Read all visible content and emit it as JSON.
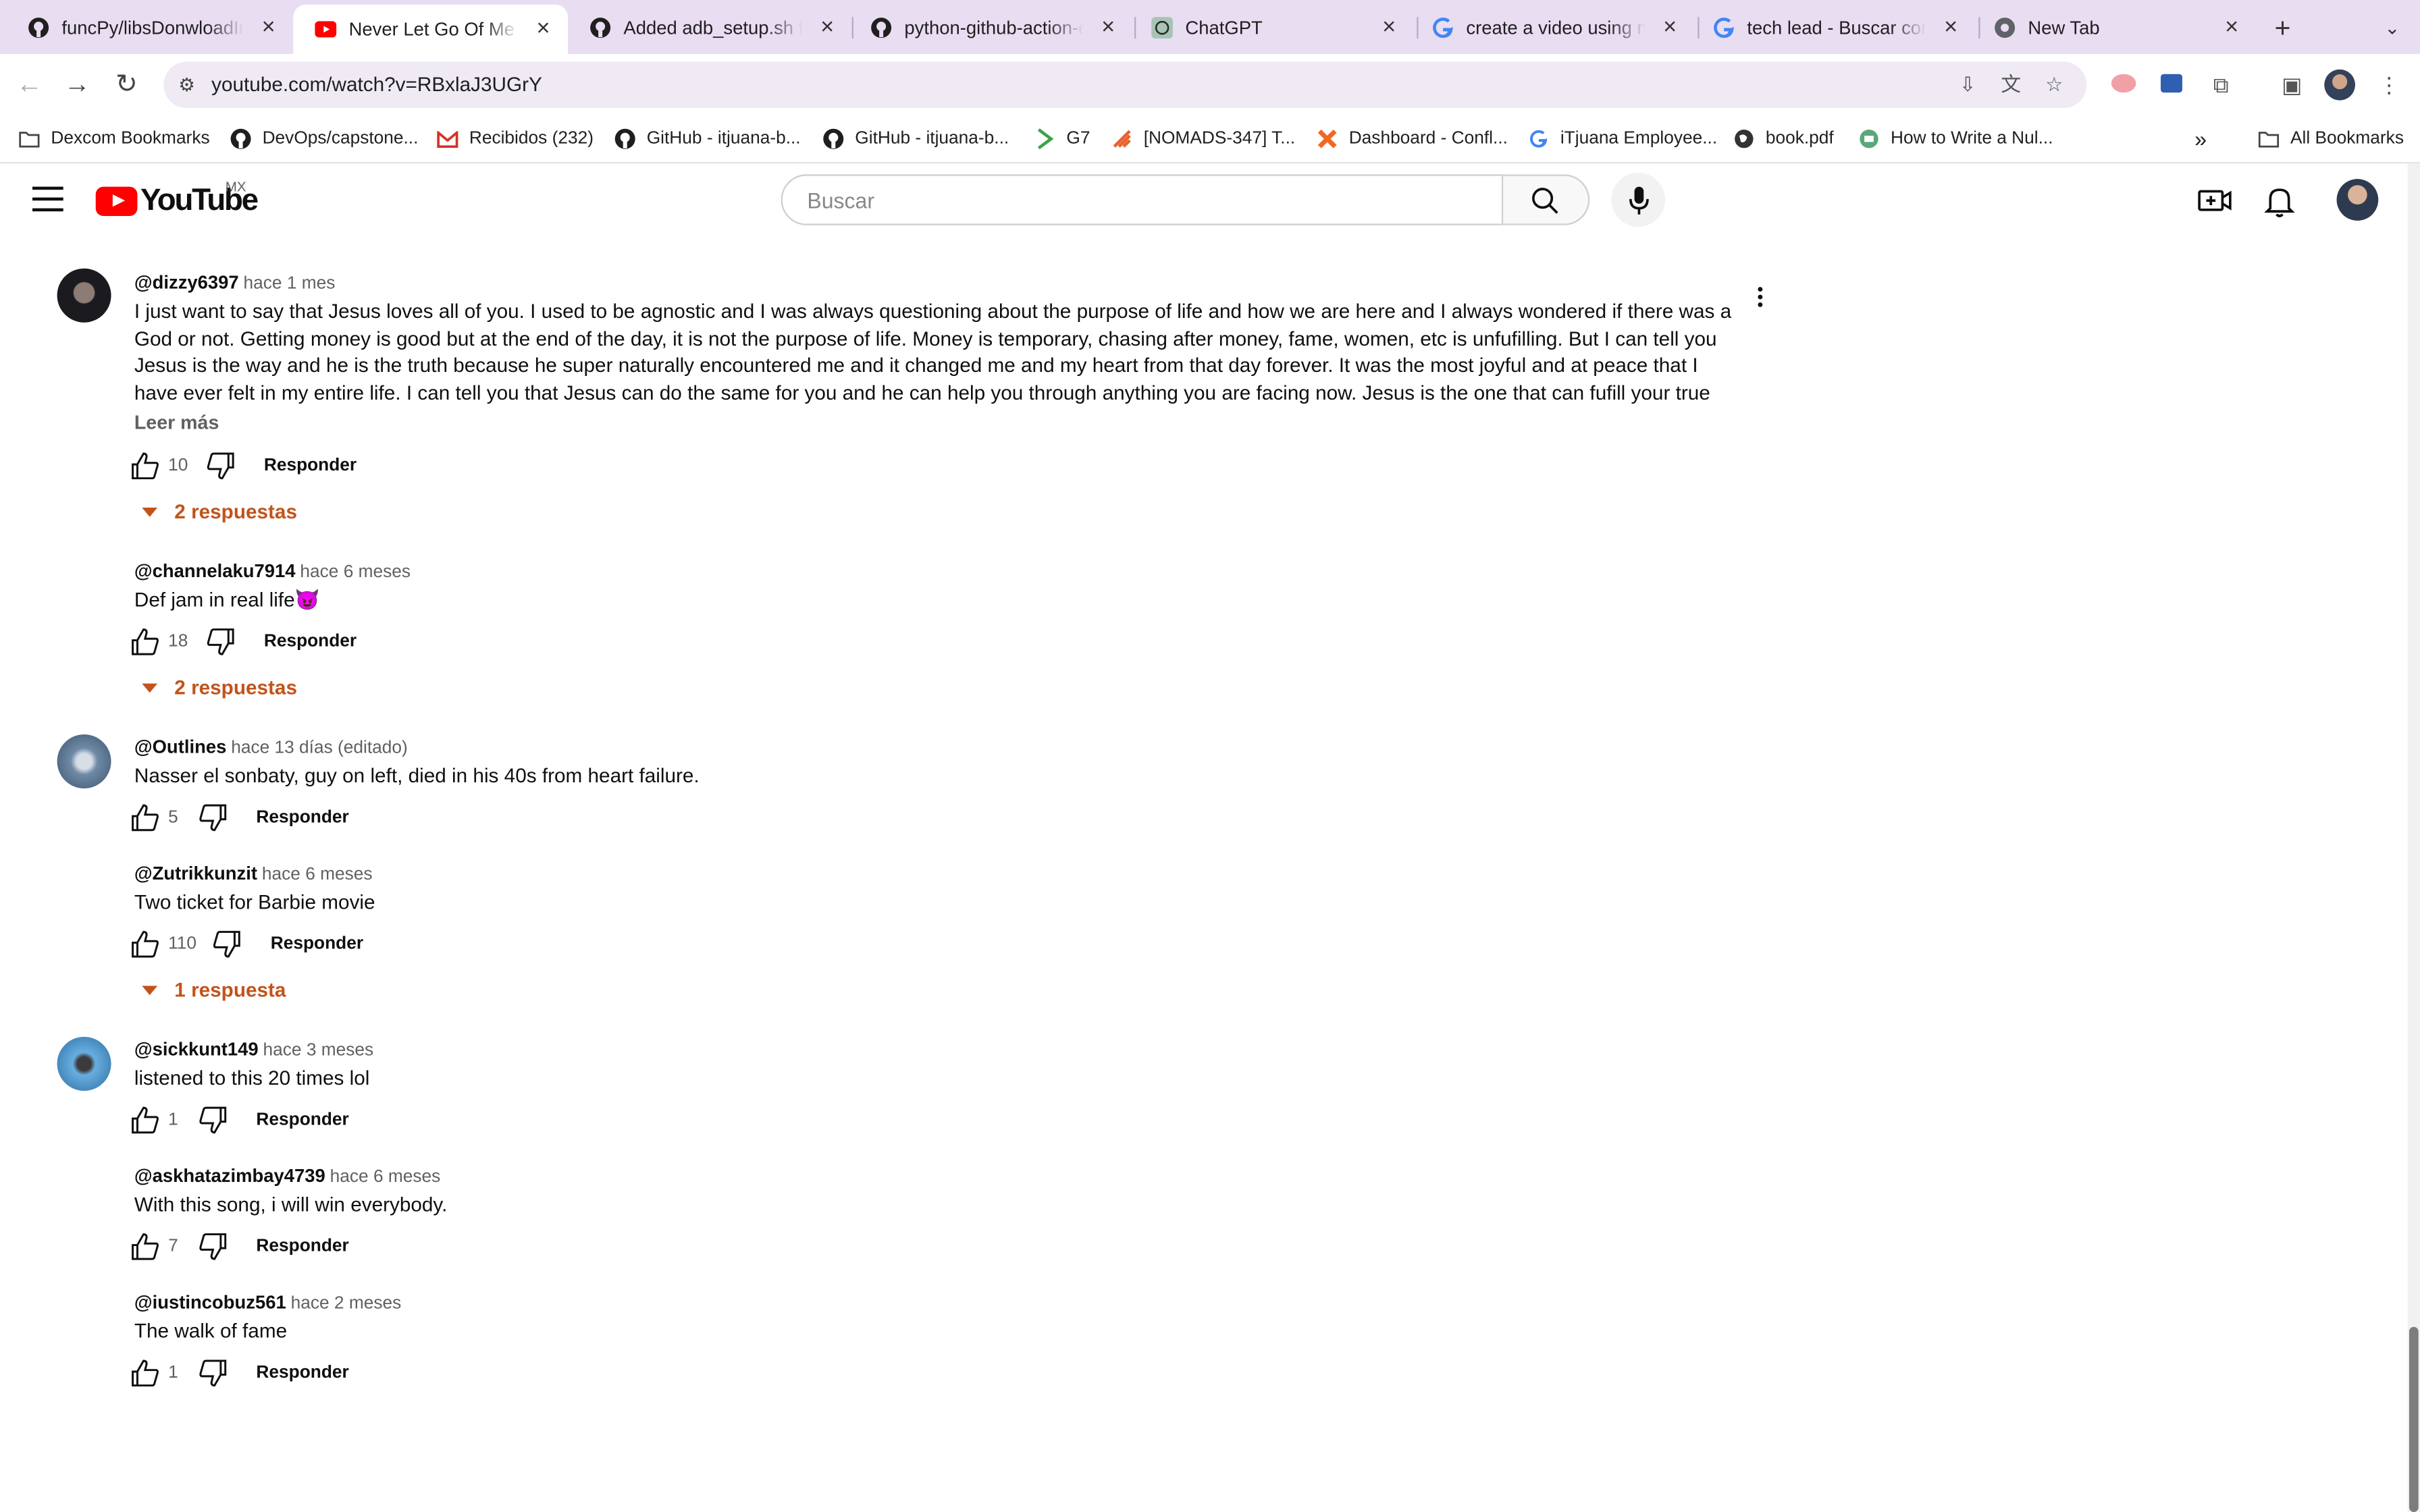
{
  "browser": {
    "tabs": [
      {
        "title": "funcPy/libsDonwloadInfo",
        "icon": "github-icon"
      },
      {
        "title": "Never Let Go Of Me - Ba",
        "icon": "youtube-icon",
        "active": true
      },
      {
        "title": "Added adb_setup.sh for",
        "icon": "github-icon"
      },
      {
        "title": "python-github-action-e",
        "icon": "github-icon"
      },
      {
        "title": "ChatGPT",
        "icon": "chatgpt-icon"
      },
      {
        "title": "create a video using ms",
        "icon": "google-icon"
      },
      {
        "title": "tech lead - Buscar con G",
        "icon": "google-icon"
      },
      {
        "title": "New Tab",
        "icon": "chrome-icon"
      }
    ],
    "url": "youtube.com/watch?v=RBxlaJ3UGrY",
    "bookmarks": [
      {
        "label": "Dexcom Bookmarks",
        "icon": "folder-icon"
      },
      {
        "label": "DevOps/capstone...",
        "icon": "github-icon"
      },
      {
        "label": "Recibidos (232)",
        "icon": "gmail-icon"
      },
      {
        "label": "GitHub - itjuana-b...",
        "icon": "github-icon"
      },
      {
        "label": "GitHub - itjuana-b...",
        "icon": "github-icon"
      },
      {
        "label": "G7",
        "icon": "g7-icon"
      },
      {
        "label": "[NOMADS-347] T...",
        "icon": "jira-icon"
      },
      {
        "label": "Dashboard - Confl...",
        "icon": "confluence-icon"
      },
      {
        "label": "iTjuana Employee...",
        "icon": "google-icon"
      },
      {
        "label": "book.pdf",
        "icon": "globe-icon"
      },
      {
        "label": "How to Write a Nul...",
        "icon": "site-icon"
      }
    ],
    "all_bookmarks": "All Bookmarks"
  },
  "youtube": {
    "logo_text": "YouTube",
    "country": "MX",
    "search_placeholder": "Buscar"
  },
  "comments": [
    {
      "handle": "@dizzy6397",
      "time": "hace 1 mes",
      "text": "I just want to say that Jesus loves all of you. I used to be agnostic and I was always questioning about the purpose of life and how we are here and I always wondered if there was a God or not. Getting money is good but at the end of the day, it is not the purpose of life. Money is temporary, chasing after money, fame, women, etc is unfufilling. But I can tell you Jesus is the way and he is the truth because he super naturally encountered me and it changed me and my heart from that day forever. It was the most joyful and at peace that I have ever felt in my entire life. I can tell you that Jesus can do the same for you and he can help you through anything you are facing now. Jesus is the one that can fufill your true purpose in life. Following Jesus is not about a …",
      "read_more": "Leer más",
      "likes": "10",
      "reply": "Responder",
      "replies": "2 respuestas"
    },
    {
      "handle": "@channelaku7914",
      "time": "hace 6 meses",
      "text": "Def jam in real life😈",
      "likes": "18",
      "reply": "Responder",
      "replies": "2 respuestas"
    },
    {
      "handle": "@Outlines",
      "time": "hace 13 días (editado)",
      "text": "Nasser el sonbaty, guy on left, died in his 40s from heart failure.",
      "likes": "5",
      "reply": "Responder"
    },
    {
      "handle": "@Zutrikkunzit",
      "time": "hace 6 meses",
      "text": "Two ticket for Barbie movie",
      "likes": "110",
      "reply": "Responder",
      "replies": "1 respuesta"
    },
    {
      "handle": "@sickkunt149",
      "time": "hace 3 meses",
      "text": "listened to this 20 times lol",
      "likes": "1",
      "reply": "Responder"
    },
    {
      "handle": "@askhatazimbay4739",
      "time": "hace 6 meses",
      "text": "With this song, i will win everybody.",
      "likes": "7",
      "reply": "Responder"
    },
    {
      "handle": "@iustincobuz561",
      "time": "hace 2 meses",
      "text": "The walk of fame",
      "likes": "1",
      "reply": "Responder"
    }
  ],
  "colors": {
    "tab_strip": "#e9ddf2",
    "replies_accent": "#c2531b",
    "youtube_red": "#ff0000"
  }
}
